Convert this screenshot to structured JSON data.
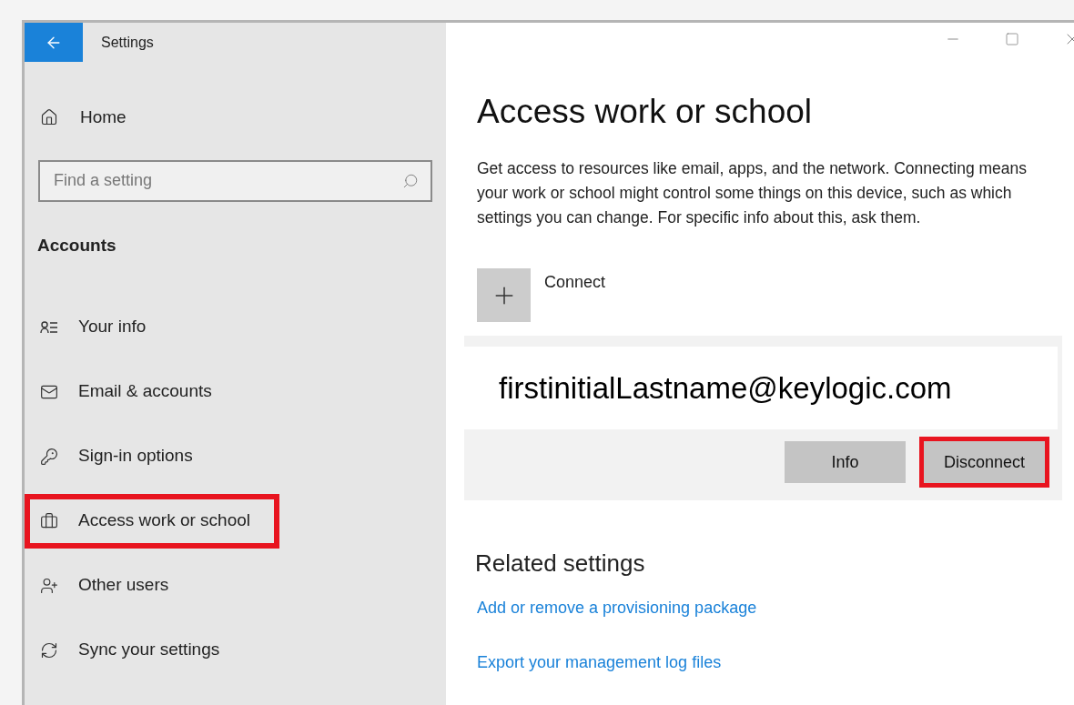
{
  "window": {
    "title": "Settings"
  },
  "sidebar": {
    "home": "Home",
    "search": {
      "placeholder": "Find a setting"
    },
    "section": "Accounts",
    "items": [
      {
        "label": "Your info",
        "highlighted": false
      },
      {
        "label": "Email & accounts",
        "highlighted": false
      },
      {
        "label": "Sign-in options",
        "highlighted": false
      },
      {
        "label": "Access work or school",
        "highlighted": true
      },
      {
        "label": "Other users",
        "highlighted": false
      },
      {
        "label": "Sync your settings",
        "highlighted": false
      }
    ]
  },
  "main": {
    "title": "Access work or school",
    "description": "Get access to resources like email, apps, and the network. Connecting means your work or school might control some things on this device, such as which settings you can change. For specific info about this, ask them.",
    "connect": "Connect",
    "account": {
      "email": "firstinitialLastname@keylogic.com",
      "buttons": [
        {
          "label": "Info",
          "highlighted": false
        },
        {
          "label": "Disconnect",
          "highlighted": true
        }
      ]
    },
    "related_title": "Related settings",
    "links": [
      "Add or remove a provisioning package",
      "Export your management log files"
    ]
  }
}
